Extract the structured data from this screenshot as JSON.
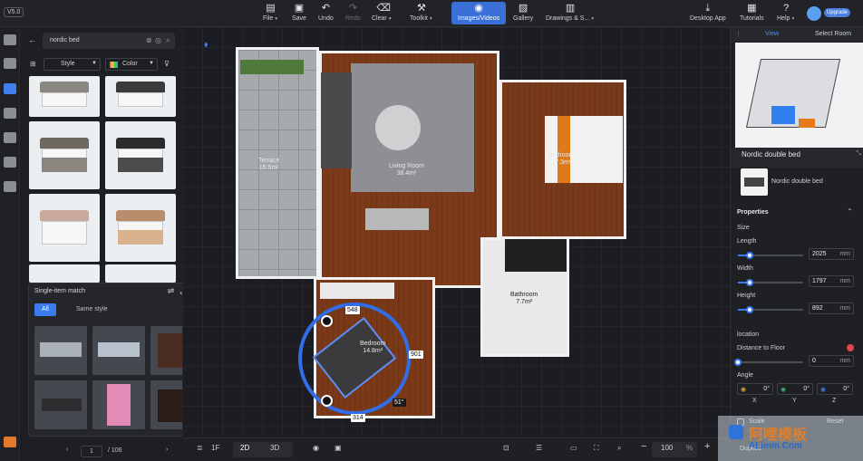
{
  "app": {
    "version": "V5.0"
  },
  "toolbar": {
    "items": [
      {
        "label": "File",
        "icon": "file-icon"
      },
      {
        "label": "Save",
        "icon": "save-icon"
      },
      {
        "label": "Undo",
        "icon": "undo-icon"
      },
      {
        "label": "Redo",
        "icon": "redo-icon"
      },
      {
        "label": "Clear",
        "icon": "clear-icon"
      },
      {
        "label": "Toolkit",
        "icon": "toolkit-icon"
      },
      {
        "label": "Images/Videos",
        "icon": "camera-icon"
      },
      {
        "label": "Gallery",
        "icon": "gallery-icon"
      },
      {
        "label": "Drawings & S...",
        "icon": "drawings-icon"
      },
      {
        "label": "Desktop App",
        "icon": "desktop-download-icon"
      },
      {
        "label": "Tutorials",
        "icon": "tutorials-icon"
      },
      {
        "label": "Help",
        "icon": "help-icon"
      }
    ],
    "upgrade_label": "Upgrade"
  },
  "search": {
    "value": "nordic bed"
  },
  "filters": {
    "style": "Style",
    "color": "Color"
  },
  "match_panel": {
    "title": "Single-item match",
    "tabs": [
      "All",
      "Same style"
    ]
  },
  "pagination": {
    "current": "1",
    "total": "/ 106"
  },
  "floorplan": {
    "rooms": [
      {
        "name": "Terrace",
        "area": "15.5m²"
      },
      {
        "name": "Living Room",
        "area": "38.4m²"
      },
      {
        "name": "Bedroom",
        "area": "17.3m²"
      },
      {
        "name": "Bathroom",
        "area": "7.7m²"
      },
      {
        "name": "Bedroom",
        "area": "14.8m²"
      }
    ],
    "dims": {
      "top": "548",
      "right": "901",
      "bottom": "314",
      "angle": "51°"
    }
  },
  "bottom": {
    "floor": "1F",
    "view2d": "2D",
    "view3d": "3D",
    "zoom": "100",
    "zoom_unit": "%"
  },
  "right_panel": {
    "tabs": [
      "View",
      "Select Room"
    ],
    "object_title": "Nordic double bed",
    "object_name": "Nordic double bed",
    "properties_label": "Properties",
    "size_label": "Size",
    "length_label": "Length",
    "length_value": "2025",
    "length_fill": 0.18,
    "width_label": "Width",
    "width_value": "1797",
    "width_fill": 0.18,
    "height_label": "Height",
    "height_value": "892",
    "height_fill": 0.18,
    "unit": "mm",
    "location_label": "location",
    "distance_label": "Distance to Floor",
    "distance_value": "0",
    "angle_label": "Angle",
    "angle_values": [
      "0°",
      "0°",
      "0°"
    ],
    "axes": [
      "X",
      "Y",
      "Z"
    ],
    "scale_label": "Scale",
    "reset_label": "Reset",
    "duplicate_label": "Duplica"
  },
  "watermark": {
    "brand": "阿哩模板",
    "url": "ALimm.Com"
  },
  "colors": {
    "accent": "#3b7cf0",
    "floor_wood": "#7a3c1c",
    "rotate_ring": "#2f6ee8"
  }
}
